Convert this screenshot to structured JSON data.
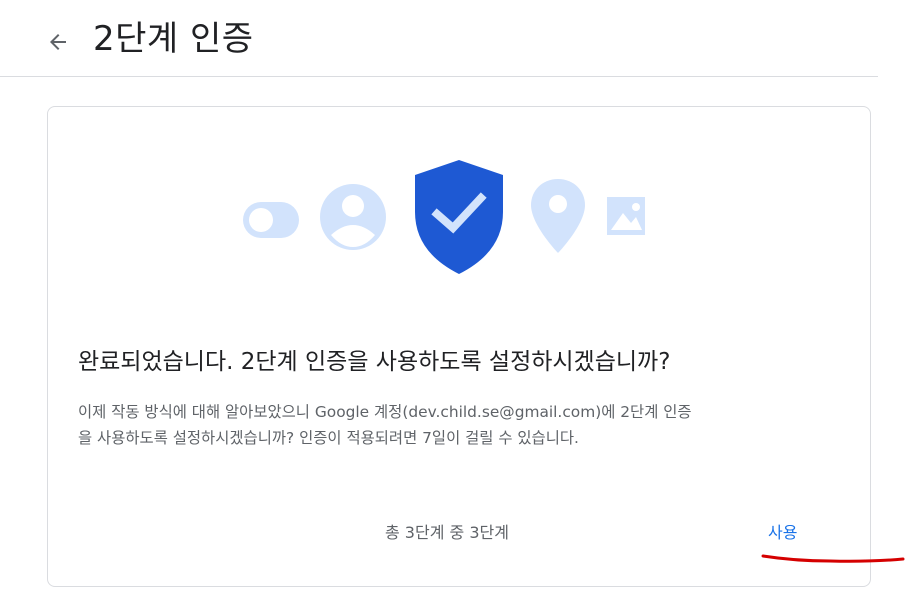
{
  "header": {
    "back_icon": "arrow-back-icon",
    "title": "2단계 인증"
  },
  "card": {
    "illustration_icons": [
      "toggle-icon",
      "account-circle-icon",
      "shield-check-icon",
      "location-pin-icon",
      "image-icon"
    ],
    "headline": "완료되었습니다. 2단계 인증을 사용하도록 설정하시겠습니까?",
    "description_line1": "이제 작동 방식에 대해 알아보았으니 Google 계정(dev.child.se@gmail.com)에 2단계 인증",
    "description_line2": "을 사용하도록 설정하시겠습니까? 인증이 적용되려면 7일이 걸릴 수 있습니다.",
    "step_text": "총 3단계 중 3단계",
    "use_button_label": "사용"
  },
  "colors": {
    "accent": "#1a73e8",
    "shield": "#1e59d3",
    "illustration_light": "#d2e3fc",
    "annotation": "#d50000"
  }
}
